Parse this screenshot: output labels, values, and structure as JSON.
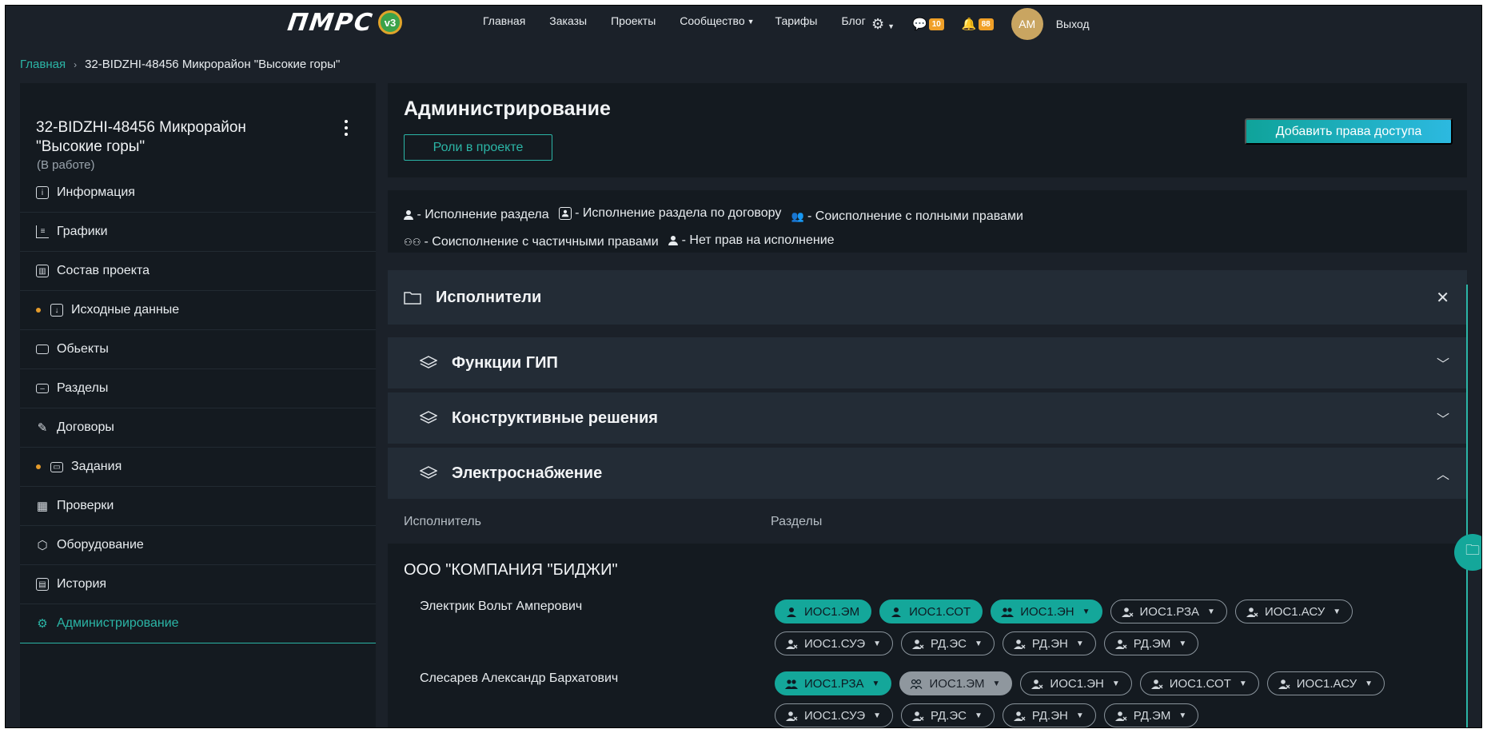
{
  "header": {
    "logo_text": "ПМРС",
    "logo_version": "v3",
    "nav": [
      "Главная",
      "Заказы",
      "Проекты",
      "Сообщество",
      "Тарифы",
      "Блог"
    ],
    "messages_count": "10",
    "notifications_count": "88",
    "avatar_initials": "АМ",
    "logout": "Выход"
  },
  "breadcrumb": {
    "home": "Главная",
    "current": "32-BIDZHI-48456 Микрорайон \"Высокие горы\""
  },
  "sidebar": {
    "project_title": "32-BIDZHI-48456 Микрорайон \"Высокие горы\"",
    "project_status": "(В работе)",
    "items": [
      {
        "label": "Информация",
        "icon": "info-icon",
        "dot": false
      },
      {
        "label": "Графики",
        "icon": "gantt-icon",
        "dot": false
      },
      {
        "label": "Состав проекта",
        "icon": "report-icon",
        "dot": false
      },
      {
        "label": "Исходные данные",
        "icon": "download-icon",
        "dot": true
      },
      {
        "label": "Обьекты",
        "icon": "box-icon",
        "dot": false
      },
      {
        "label": "Разделы",
        "icon": "sections-icon",
        "dot": false
      },
      {
        "label": "Договоры",
        "icon": "pen-icon",
        "dot": false
      },
      {
        "label": "Задания",
        "icon": "tasks-icon",
        "dot": true
      },
      {
        "label": "Проверки",
        "icon": "grid-icon",
        "dot": false
      },
      {
        "label": "Оборудование",
        "icon": "cube-icon",
        "dot": false
      },
      {
        "label": "История",
        "icon": "history-icon",
        "dot": false
      },
      {
        "label": "Администрирование",
        "icon": "gear-icon",
        "dot": false,
        "active": true
      }
    ]
  },
  "admin": {
    "title": "Администрирование",
    "roles_button": "Роли в проекте",
    "add_button": "Добавить права доступа"
  },
  "legend": {
    "items": [
      "- Исполнение раздела",
      "- Исполнение раздела по договору",
      "- Соисполнение с полными правами",
      "- Соисполнение с частичными правами",
      "- Нет прав на исполнение"
    ]
  },
  "accordions": {
    "executors": "Исполнители",
    "gip": "Функции ГИП",
    "constructive": "Конструктивные решения",
    "power": "Электроснабжение"
  },
  "table": {
    "col_executor": "Исполнитель",
    "col_sections": "Разделы",
    "company": "ООО \"КОМПАНИЯ \"БИДЖИ\"",
    "people": [
      {
        "name": "Электрик Вольт Амперович",
        "chips": [
          {
            "label": "ИОС1.ЭМ",
            "style": "filled",
            "icon": "person",
            "dropdown": false
          },
          {
            "label": "ИОС1.СОТ",
            "style": "filled",
            "icon": "person",
            "dropdown": false
          },
          {
            "label": "ИОС1.ЭН",
            "style": "filled",
            "icon": "persons-full",
            "dropdown": true
          },
          {
            "label": "ИОС1.РЗА",
            "style": "outline",
            "icon": "person-none",
            "dropdown": true
          },
          {
            "label": "ИОС1.АСУ",
            "style": "outline",
            "icon": "person-none",
            "dropdown": true
          },
          {
            "label": "ИОС1.СУЭ",
            "style": "outline",
            "icon": "person-none",
            "dropdown": true
          },
          {
            "label": "РД.ЭС",
            "style": "outline",
            "icon": "person-none",
            "dropdown": true
          },
          {
            "label": "РД.ЭН",
            "style": "outline",
            "icon": "person-none",
            "dropdown": true
          },
          {
            "label": "РД.ЭМ",
            "style": "outline",
            "icon": "person-none",
            "dropdown": true
          }
        ]
      },
      {
        "name": "Слесарев Александр Бархатович",
        "chips": [
          {
            "label": "ИОС1.РЗА",
            "style": "filled",
            "icon": "persons-full",
            "dropdown": true
          },
          {
            "label": "ИОС1.ЭМ",
            "style": "grey",
            "icon": "persons-partial",
            "dropdown": true
          },
          {
            "label": "ИОС1.ЭН",
            "style": "outline",
            "icon": "person-none",
            "dropdown": true
          },
          {
            "label": "ИОС1.СОТ",
            "style": "outline",
            "icon": "person-none",
            "dropdown": true
          },
          {
            "label": "ИОС1.АСУ",
            "style": "outline",
            "icon": "person-none",
            "dropdown": true
          },
          {
            "label": "ИОС1.СУЭ",
            "style": "outline",
            "icon": "person-none",
            "dropdown": true
          },
          {
            "label": "РД.ЭС",
            "style": "outline",
            "icon": "person-none",
            "dropdown": true
          },
          {
            "label": "РД.ЭН",
            "style": "outline",
            "icon": "person-none",
            "dropdown": true
          },
          {
            "label": "РД.ЭМ",
            "style": "outline",
            "icon": "person-none",
            "dropdown": true
          }
        ]
      }
    ]
  },
  "colors": {
    "accent": "#2bb5a6",
    "badge": "#f0a028",
    "background": "#1b2129",
    "panel": "#141a20"
  }
}
